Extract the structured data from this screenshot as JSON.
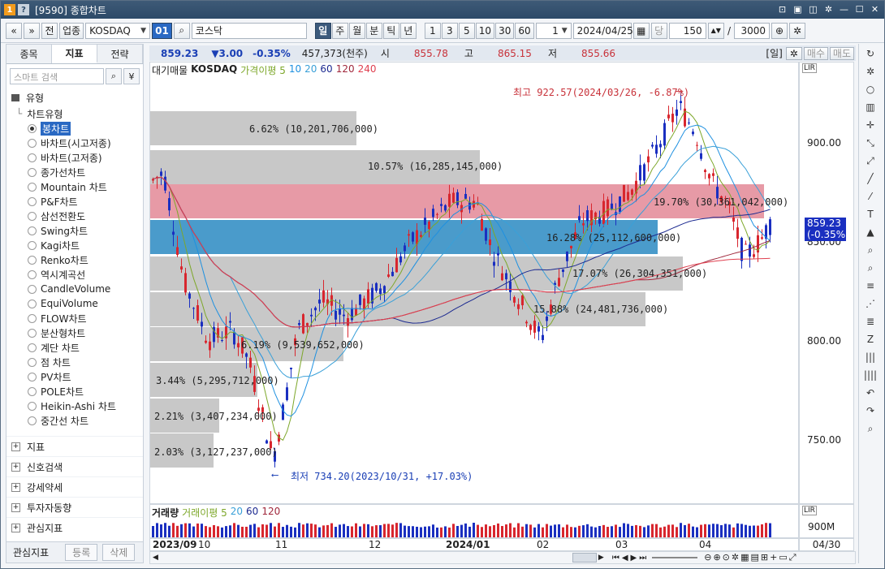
{
  "window": {
    "title": "[9590] 종합차트",
    "badge1": "1",
    "badge2": "?"
  },
  "toolbar": {
    "nav_prev": "«",
    "nav_down": "»",
    "btn_jeon": "전",
    "btn_upjong": "업종",
    "market_select": "KOSDAQ",
    "code_box": "01",
    "stock_name": "코스닥",
    "period_buttons": [
      "일",
      "주",
      "월",
      "분",
      "틱",
      "년"
    ],
    "active_period": "일",
    "interval_buttons": [
      "1",
      "3",
      "5",
      "10",
      "30",
      "60"
    ],
    "count_value": "1",
    "date_value": "2024/04/25",
    "dang_label": "당",
    "bar_count": "150",
    "slash": "/",
    "max_count": "3000"
  },
  "left_panel": {
    "tabs": [
      "종목",
      "지표",
      "전략"
    ],
    "active_tab": "지표",
    "search_placeholder": "스마트 검색",
    "root_label": "유형",
    "chart_type_label": "차트유형",
    "chart_types": [
      "봉차트",
      "바차트(시고저종)",
      "바차트(고저종)",
      "종가선차트",
      "Mountain 차트",
      "P&F차트",
      "삼선전환도",
      "Swing차트",
      "Kagi차트",
      "Renko차트",
      "역시계곡선",
      "CandleVolume",
      "EquiVolume",
      "FLOW차트",
      "분산형차트",
      "계단 차트",
      "점 차트",
      "PV차트",
      "POLE차트",
      "Heikin-Ashi 차트",
      "중간선 차트"
    ],
    "selected_type": "봉차트",
    "groups": [
      "지표",
      "신호검색",
      "강세약세",
      "투자자동향",
      "관심지표"
    ],
    "footer_label": "관심지표",
    "footer_btn_register": "등록",
    "footer_btn_delete": "삭제"
  },
  "quote": {
    "price": "859.23",
    "change": "▼3.00",
    "change_pct": "-0.35%",
    "volume": "457,373(천주)",
    "open_label": "시",
    "open": "855.78",
    "high_label": "고",
    "high": "865.15",
    "low_label": "저",
    "low": "855.66",
    "period_tag": "[일]",
    "buy_label": "매수",
    "sell_label": "매도"
  },
  "chart_legend": {
    "items": [
      "대기매물",
      "KOSDAQ",
      "가격이평 5",
      "10",
      "20",
      "60",
      "120",
      "240"
    ]
  },
  "volume_legend": {
    "items": [
      "거래량",
      "거래이평 5",
      "20",
      "60",
      "120"
    ]
  },
  "annotations": {
    "high_note": "최고 922.57(2024/03/26, -6.87%)",
    "low_note": "최저 734.20(2023/10/31, +17.03%)",
    "price_tag": "859.23",
    "price_tag_pct": "(-0.35%)"
  },
  "volume_profile": [
    {
      "label": "6.62% (10,201,706,000)",
      "pct": 6.62
    },
    {
      "label": "10.57% (16,285,145,000)",
      "pct": 10.57
    },
    {
      "label": "19.70% (30,361,042,000)",
      "pct": 19.7
    },
    {
      "label": "16.28% (25,112,600,000)",
      "pct": 16.28
    },
    {
      "label": "17.07% (26,304,351,000)",
      "pct": 17.07
    },
    {
      "label": "15.88% (24,481,736,000)",
      "pct": 15.88
    },
    {
      "label": "6.19% (9,539,652,000)",
      "pct": 6.19
    },
    {
      "label": "3.44% (5,295,712,000)",
      "pct": 3.44
    },
    {
      "label": "2.21% (3,407,234,000)",
      "pct": 2.21
    },
    {
      "label": "2.03% (3,127,237,000)",
      "pct": 2.03
    }
  ],
  "y_axis": {
    "ticks": [
      "900.00",
      "850.00",
      "800.00",
      "750.00"
    ],
    "lir": "LIR",
    "vol_tick": "900M",
    "date_right": "04/30"
  },
  "x_axis": {
    "labels": [
      "2023/09",
      "10",
      "11",
      "12",
      "2024/01",
      "02",
      "03",
      "04"
    ]
  },
  "colors": {
    "up": "#d8262e",
    "down": "#1a2fc0",
    "poc": "#e79aa6",
    "current_band": "#4a9bcb",
    "profile": "#c8c8c8"
  }
}
